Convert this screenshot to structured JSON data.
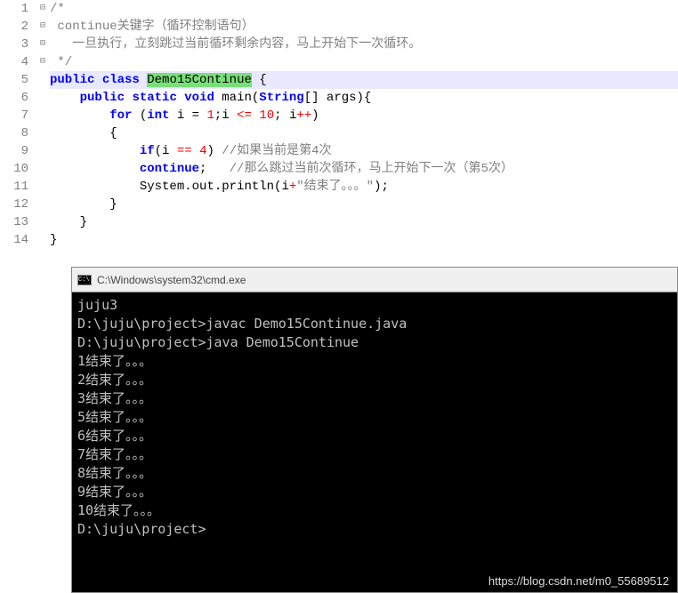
{
  "editor": {
    "line_numbers": [
      "1",
      "2",
      "3",
      "4",
      "5",
      "6",
      "7",
      "8",
      "9",
      "10",
      "11",
      "12",
      "13",
      "14"
    ],
    "fold_markers": [
      "⊟",
      "",
      "",
      "",
      "⊟",
      "⊟",
      "",
      "⊟",
      "",
      "",
      "",
      "",
      "",
      ""
    ],
    "code": {
      "l1_comment_open": "/*",
      "l2_comment": "continue关键字（循环控制语句）",
      "l3_comment": "  一旦执行，立刻跳过当前循环剩余内容，马上开始下一次循环。",
      "l4_comment_close": " */",
      "l5_public": "public",
      "l5_class": "class",
      "l5_classname": "Demo15Continue",
      "l5_brace": " {",
      "l6_public": "public",
      "l6_static": "static",
      "l6_void": "void",
      "l6_main": " main",
      "l6_string": "String",
      "l6_args": "[] args){",
      "l7_for": "for",
      "l7_open": " (",
      "l7_int": "int",
      "l7_init": " i = ",
      "l7_one": "1",
      "l7_cond": ";i ",
      "l7_le": "<=",
      "l7_ten": " 10",
      "l7_step": "; i",
      "l7_inc": "++",
      "l7_close": ")",
      "l8_brace": "{",
      "l9_if": "if",
      "l9_open": "(i ",
      "l9_eq": "==",
      "l9_four": " 4",
      "l9_close": ") ",
      "l9_comment": "//如果当前是第4次",
      "l10_continue": "continue",
      "l10_semi": ";   ",
      "l10_comment": "//那么跳过当前次循环，马上开始下一次（第5次）",
      "l11_sysout": "System.out.println(i",
      "l11_plus": "+",
      "l11_str": "\"结束了。。。\"",
      "l11_close": ");",
      "l12_brace": "}",
      "l13_brace": "}",
      "l14_brace": "}"
    }
  },
  "terminal": {
    "title": "C:\\Windows\\system32\\cmd.exe",
    "lines": [
      "juju3",
      "",
      "D:\\juju\\project>javac Demo15Continue.java",
      "",
      "D:\\juju\\project>java Demo15Continue",
      "1结束了。。。",
      "2结束了。。。",
      "3结束了。。。",
      "5结束了。。。",
      "6结束了。。。",
      "7结束了。。。",
      "8结束了。。。",
      "9结束了。。。",
      "10结束了。。。",
      "",
      "D:\\juju\\project>"
    ]
  },
  "watermark": "https://blog.csdn.net/m0_55689512"
}
